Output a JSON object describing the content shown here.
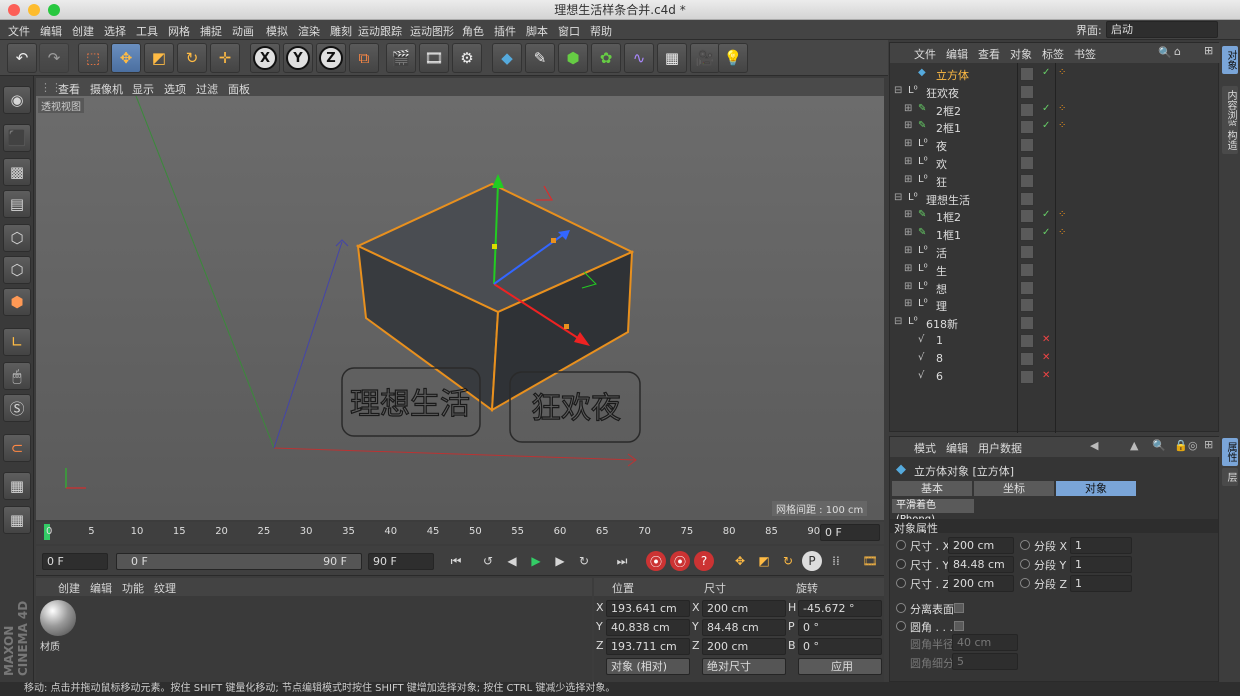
{
  "window": {
    "title": "理想生活样条合并.c4d *"
  },
  "menu": [
    "文件",
    "编辑",
    "创建",
    "选择",
    "工具",
    "网格",
    "捕捉",
    "动画",
    "模拟",
    "渲染",
    "雕刻",
    "运动跟踪",
    "运动图形",
    "角色",
    "插件",
    "脚本",
    "窗口",
    "帮助"
  ],
  "interface": {
    "label": "界面:",
    "value": "启动"
  },
  "viewport": {
    "menu": [
      "查看",
      "摄像机",
      "显示",
      "选项",
      "过滤",
      "面板"
    ],
    "name": "透视视图",
    "grid": "网格间距 : 100 cm",
    "text1": "理想生活",
    "text2": "狂欢夜"
  },
  "timeline": {
    "ticks": [
      "0",
      "5",
      "10",
      "15",
      "20",
      "25",
      "30",
      "35",
      "40",
      "45",
      "50",
      "55",
      "60",
      "65",
      "70",
      "75",
      "80",
      "85",
      "90"
    ],
    "frame": "0 F"
  },
  "playback": {
    "start": "0 F",
    "range_start": "0 F",
    "range_end": "90 F",
    "end": "90 F"
  },
  "materials": {
    "menu": [
      "创建",
      "编辑",
      "功能",
      "纹理"
    ],
    "mat_name": "材质"
  },
  "coords": {
    "headers": [
      "位置",
      "尺寸",
      "旋转"
    ],
    "rows": [
      {
        "a": "X",
        "pos": "193.641 cm",
        "b": "X",
        "size": "200 cm",
        "c": "H",
        "rot": "-45.672 °"
      },
      {
        "a": "Y",
        "pos": "40.838 cm",
        "b": "Y",
        "size": "84.48 cm",
        "c": "P",
        "rot": "0 °"
      },
      {
        "a": "Z",
        "pos": "193.711 cm",
        "b": "Z",
        "size": "200 cm",
        "c": "B",
        "rot": "0 °"
      }
    ],
    "mode1": "对象 (相对)",
    "mode2": "绝对尺寸",
    "apply": "应用"
  },
  "objmgr": {
    "menu": [
      "文件",
      "编辑",
      "查看",
      "对象",
      "标签",
      "书签"
    ],
    "items": [
      {
        "name": "立方体",
        "indent": 1,
        "type": "cube",
        "sel": true,
        "check": "on",
        "tag": true
      },
      {
        "name": "狂欢夜",
        "indent": 0,
        "type": "null",
        "exp": "-"
      },
      {
        "name": "2框2",
        "indent": 1,
        "type": "spline",
        "exp": "+",
        "check": "on",
        "tag": true
      },
      {
        "name": "2框1",
        "indent": 1,
        "type": "spline",
        "exp": "+",
        "check": "on",
        "tag": true
      },
      {
        "name": "夜",
        "indent": 1,
        "type": "null",
        "exp": "+"
      },
      {
        "name": "欢",
        "indent": 1,
        "type": "null",
        "exp": "+"
      },
      {
        "name": "狂",
        "indent": 1,
        "type": "null",
        "exp": "+"
      },
      {
        "name": "理想生活",
        "indent": 0,
        "type": "null",
        "exp": "-"
      },
      {
        "name": "1框2",
        "indent": 1,
        "type": "spline",
        "exp": "+",
        "check": "on",
        "tag": true
      },
      {
        "name": "1框1",
        "indent": 1,
        "type": "spline",
        "exp": "+",
        "check": "on",
        "tag": true
      },
      {
        "name": "活",
        "indent": 1,
        "type": "null",
        "exp": "+"
      },
      {
        "name": "生",
        "indent": 1,
        "type": "null",
        "exp": "+"
      },
      {
        "name": "想",
        "indent": 1,
        "type": "null",
        "exp": "+"
      },
      {
        "name": "理",
        "indent": 1,
        "type": "null",
        "exp": "+"
      },
      {
        "name": "618新",
        "indent": 0,
        "type": "null",
        "exp": "-"
      },
      {
        "name": "1",
        "indent": 1,
        "type": "path",
        "check": "off"
      },
      {
        "name": "8",
        "indent": 1,
        "type": "path",
        "check": "off"
      },
      {
        "name": "6",
        "indent": 1,
        "type": "path",
        "check": "off"
      }
    ]
  },
  "attr": {
    "menu": [
      "模式",
      "编辑",
      "用户数据"
    ],
    "title": "立方体对象 [立方体]",
    "tabs": [
      "基本",
      "坐标",
      "对象"
    ],
    "tab2": "平滑着色(Phong)",
    "section": "对象属性",
    "fields": [
      {
        "l": "尺寸 . X",
        "v": "200 cm",
        "l2": "分段 X",
        "v2": "1"
      },
      {
        "l": "尺寸 . Y",
        "v": "84.48 cm",
        "l2": "分段 Y",
        "v2": "1"
      },
      {
        "l": "尺寸 . Z",
        "v": "200 cm",
        "l2": "分段 Z",
        "v2": "1"
      }
    ],
    "sep": "分离表面",
    "fillet": "圆角 . . . .",
    "radius_l": "圆角半径",
    "radius_v": "40 cm",
    "sub_l": "圆角细分",
    "sub_v": "5"
  },
  "side_tabs": [
    "对象",
    "内容浏览器",
    "构造"
  ],
  "side_tabs2": [
    "属性",
    "层"
  ],
  "status": "移动: 点击并拖动鼠标移动元素。按住 SHIFT 键量化移动; 节点编辑模式时按住 SHIFT 键增加选择对象; 按住 CTRL 键减少选择对象。",
  "brand": "MAXON CINEMA 4D"
}
